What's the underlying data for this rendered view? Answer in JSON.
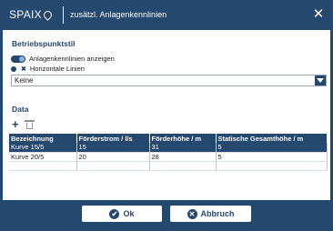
{
  "titlebar": {
    "logo": "SPAIX",
    "title": "zusätzl. Anlagenkennlinien"
  },
  "betriebspunktstil": {
    "title": "Betriebspunktstil",
    "toggle_label": "Anlagenkennlinien anzeigen",
    "legend_label": "Horizontale Linien",
    "select_value": "Keine"
  },
  "data": {
    "title": "Data",
    "columns": [
      "Bezeichnung",
      "Förderstrom / l/s",
      "Förderhöhe / m",
      "Statische Gesamthöhe / m"
    ],
    "rows": [
      [
        "Kurve 15/5",
        "15",
        "31",
        "5"
      ],
      [
        "Kurve 20/5",
        "20",
        "28",
        "5"
      ]
    ]
  },
  "footer": {
    "ok_label": "Ok",
    "cancel_label": "Abbruch"
  },
  "colors": {
    "primary": "#24486e",
    "background": "#ffffff"
  }
}
